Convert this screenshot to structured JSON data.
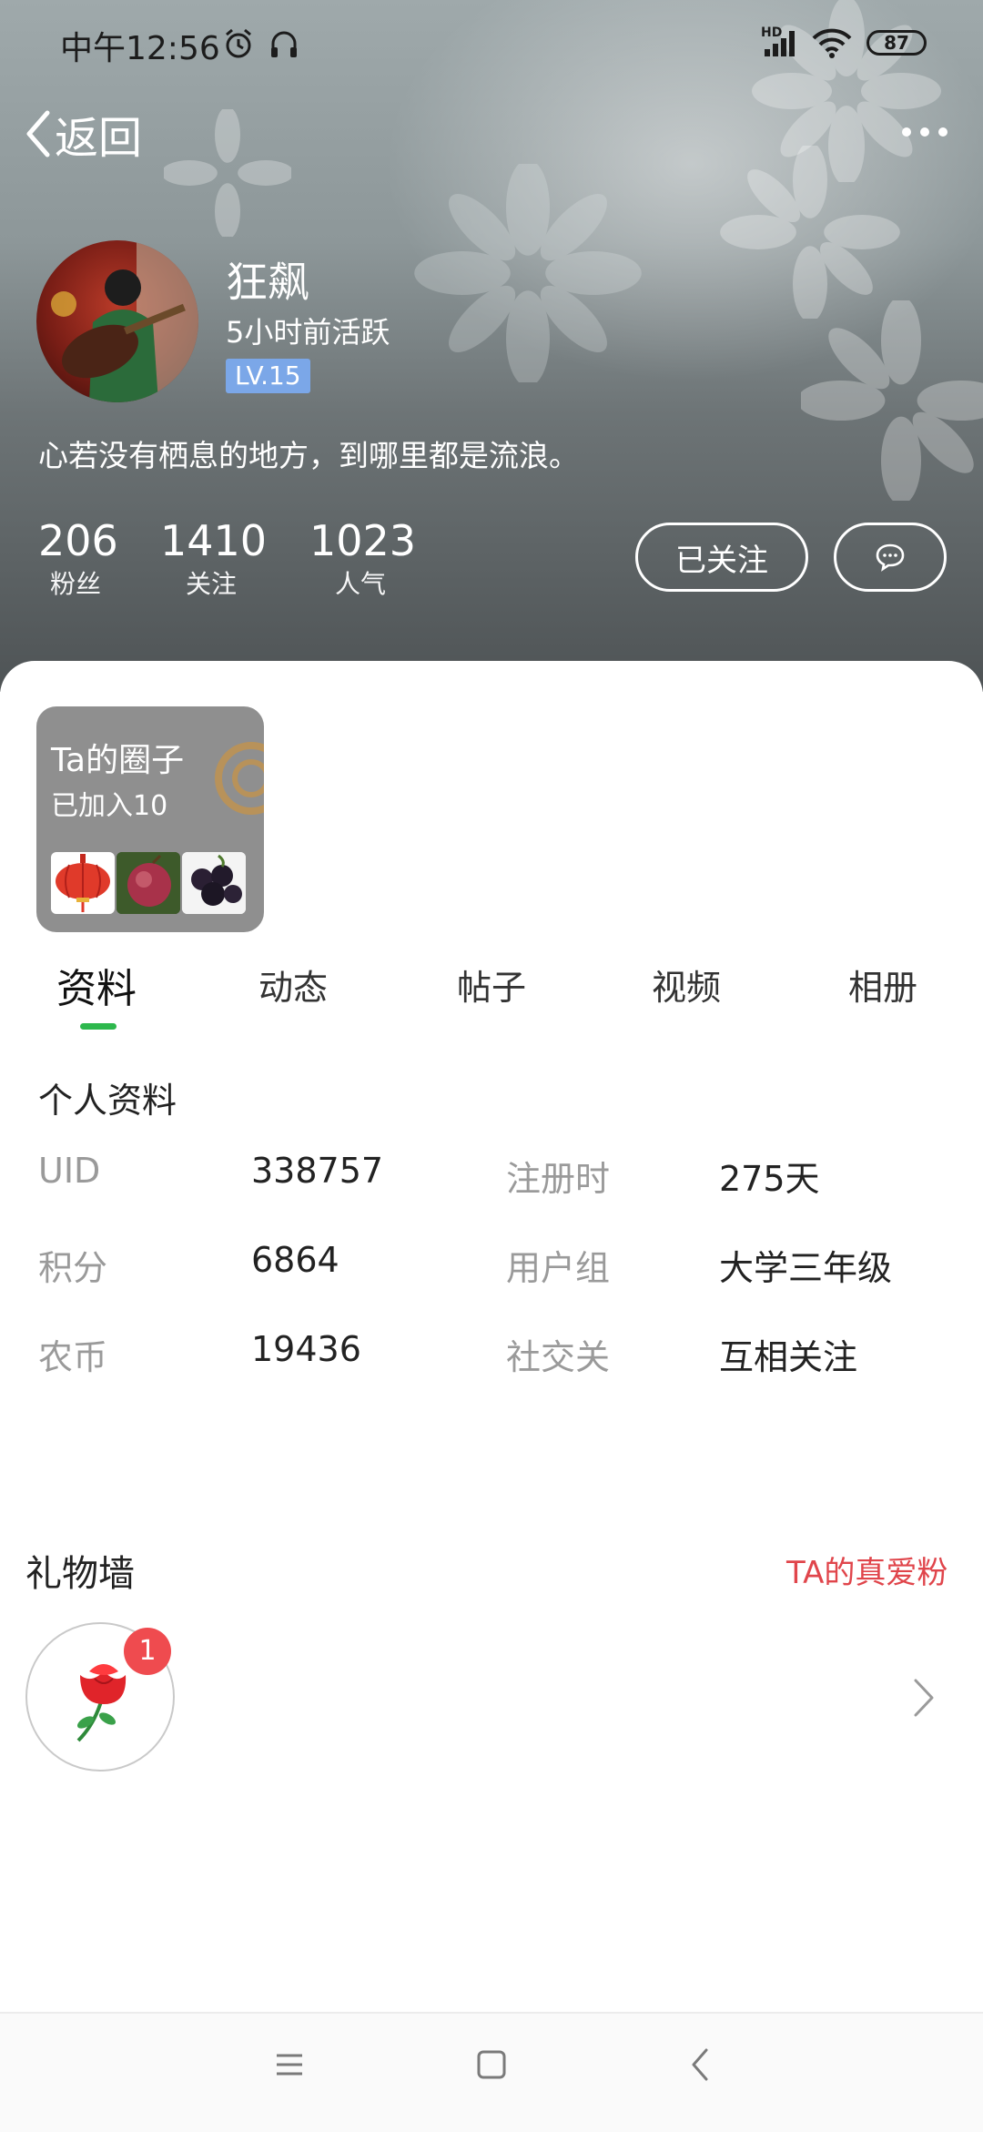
{
  "status_bar": {
    "time": "中午12:56",
    "battery": "87",
    "network": "HD",
    "icons": [
      "alarm-icon",
      "headset-icon",
      "signal-icon",
      "wifi-icon",
      "battery-icon"
    ]
  },
  "nav": {
    "back_label": "返回",
    "more_icon": "more-dots-icon"
  },
  "profile": {
    "name": "狂飙",
    "active_status": "5小时前活跃",
    "level": "LV.15",
    "bio": "心若没有栖息的地方，到哪里都是流浪。",
    "stats": [
      {
        "value": "206",
        "label": "粉丝"
      },
      {
        "value": "1410",
        "label": "关注"
      },
      {
        "value": "1023",
        "label": "人气"
      }
    ],
    "follow_label": "已关注",
    "message_icon": "chat-bubble-icon"
  },
  "circle": {
    "title": "Ta的圈子",
    "joined": "已加入10"
  },
  "tabs": [
    {
      "label": "资料",
      "active": true
    },
    {
      "label": "动态",
      "active": false
    },
    {
      "label": "帖子",
      "active": false
    },
    {
      "label": "视频",
      "active": false
    },
    {
      "label": "相册",
      "active": false
    }
  ],
  "info": {
    "section_title": "个人资料",
    "rows": [
      {
        "l1": "UID",
        "v1": "338757",
        "l2": "注册时",
        "v2": "275天"
      },
      {
        "l1": "积分",
        "v1": "6864",
        "l2": "用户组",
        "v2": "大学三年级"
      },
      {
        "l1": "农币",
        "v1": "19436",
        "l2": "社交关",
        "v2": "互相关注"
      }
    ]
  },
  "gifts": {
    "title": "礼物墙",
    "fans_link": "TA的真爱粉",
    "items": [
      {
        "icon": "rose-icon",
        "count": "1"
      }
    ]
  },
  "colors": {
    "accent_green": "#2db84d",
    "fans_red": "#e0454b",
    "level_blue": "#7ba7e8",
    "badge_red": "#ef4b4f"
  }
}
